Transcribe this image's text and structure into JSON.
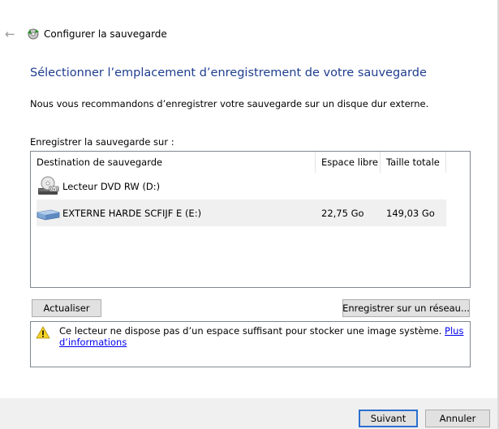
{
  "window": {
    "title": "Configurer la sauvegarde"
  },
  "page": {
    "heading": "Sélectionner l’emplacement d’enregistrement de votre sauvegarde",
    "recommendation": "Nous vous recommandons d’enregistrer votre sauvegarde sur un disque dur externe.",
    "save_on_label": "Enregistrer la sauvegarde sur :"
  },
  "table": {
    "columns": [
      "Destination de sauvegarde",
      "Espace libre",
      "Taille totale"
    ],
    "rows": [
      {
        "icon": "dvd-drive-icon",
        "name": "Lecteur DVD RW (D:)",
        "free": "",
        "total": "",
        "selected": false
      },
      {
        "icon": "external-drive-icon",
        "name": "EXTERNE HARDE SCFIJF E (E:)",
        "free": "22,75 Go",
        "total": "149,03 Go",
        "selected": true
      }
    ]
  },
  "buttons": {
    "refresh": "Actualiser",
    "save_network": "Enregistrer sur un réseau...",
    "next": "Suivant",
    "cancel": "Annuler"
  },
  "warning": {
    "icon": "warning-icon",
    "text": "Ce lecteur ne dispose pas d’un espace suffisant pour stocker une image système. ",
    "link": "Plus d’informations"
  },
  "colors": {
    "heading": "#1e3d8f",
    "selected_row": "#f0f0f0",
    "default_button_border": "#2b6fd0",
    "link": "#0000ee"
  }
}
